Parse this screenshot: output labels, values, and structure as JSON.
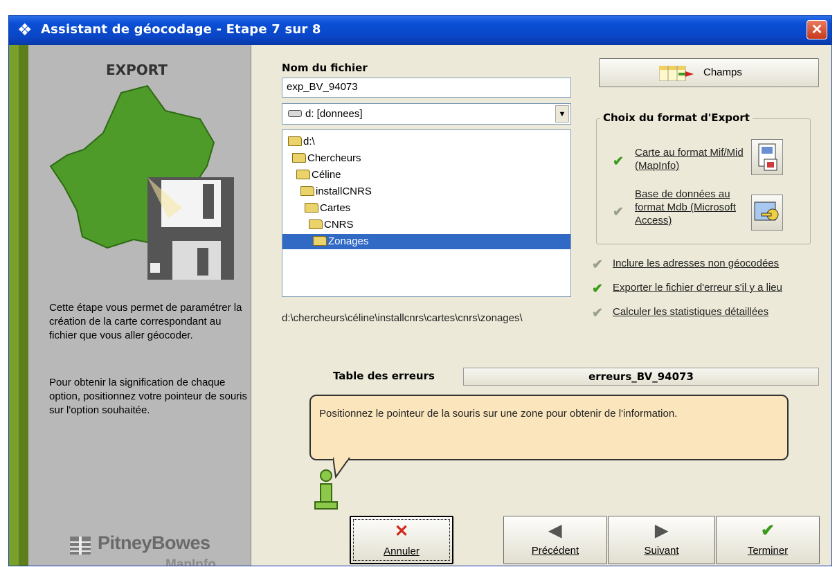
{
  "window": {
    "title": "Assistant de géocodage - Etape 7 sur 8",
    "close_glyph": "✕"
  },
  "left": {
    "heading": "EXPORT",
    "description_1": "Cette étape vous permet de paramétrer la création de la carte correspondant au fichier que vous aller géocoder.",
    "description_2": "Pour obtenir la signification de chaque option, positionnez votre pointeur de souris sur l'option souhaitée.",
    "brand_name": "PitneyBowes",
    "brand_sub": "MapInfo"
  },
  "file": {
    "label": "Nom du fichier",
    "value": "exp_BV_94073",
    "drive": "d: [donnees]",
    "folders": [
      {
        "name": "d:\\",
        "selected": false
      },
      {
        "name": "Chercheurs",
        "selected": false
      },
      {
        "name": "Céline",
        "selected": false
      },
      {
        "name": "installCNRS",
        "selected": false
      },
      {
        "name": "Cartes",
        "selected": false
      },
      {
        "name": "CNRS",
        "selected": false
      },
      {
        "name": "Zonages",
        "selected": true
      }
    ],
    "path": "d:\\chercheurs\\céline\\installcnrs\\cartes\\cnrs\\zonages\\"
  },
  "champs_button": "Champs",
  "format": {
    "legend": "Choix du format d'Export",
    "option1": "Carte au format Mif/Mid (MapInfo)",
    "option1_checked": true,
    "option2": "Base de données au format Mdb (Microsoft Access)",
    "option2_checked": false
  },
  "options": [
    {
      "label": "Inclure les adresses non géocodées",
      "checked": false
    },
    {
      "label": "Exporter le fichier d'erreur s'il y a lieu",
      "checked": true
    },
    {
      "label": "Calculer les statistiques détaillées",
      "checked": false
    }
  ],
  "errors": {
    "label": "Table des erreurs",
    "value": "erreurs_BV_94073"
  },
  "info_text": "Positionnez le pointeur de la souris sur une zone pour obtenir de l'information.",
  "buttons": {
    "cancel": "Annuler",
    "previous": "Précédent",
    "next": "Suivant",
    "finish": "Terminer"
  },
  "colors": {
    "titlebar": "#0a46c7",
    "selection": "#316ac5",
    "bubble": "#fbe5bc",
    "check_on": "#3b9a1c"
  }
}
